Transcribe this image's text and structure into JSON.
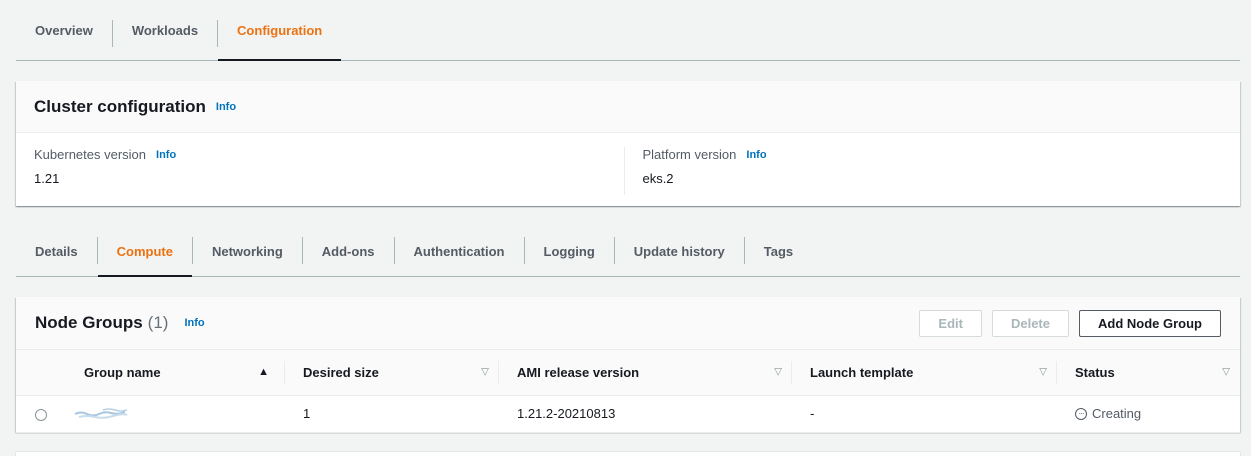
{
  "top_tabs": [
    "Overview",
    "Workloads",
    "Configuration"
  ],
  "top_active": "Configuration",
  "cluster_config": {
    "title": "Cluster configuration",
    "info": "Info",
    "k8s_label": "Kubernetes version",
    "k8s_value": "1.21",
    "platform_label": "Platform version",
    "platform_value": "eks.2"
  },
  "sub_tabs": [
    "Details",
    "Compute",
    "Networking",
    "Add-ons",
    "Authentication",
    "Logging",
    "Update history",
    "Tags"
  ],
  "sub_active": "Compute",
  "node_groups": {
    "title": "Node Groups",
    "count": "(1)",
    "info": "Info",
    "buttons": {
      "edit": "Edit",
      "delete": "Delete",
      "add": "Add Node Group"
    },
    "columns": [
      "Group name",
      "Desired size",
      "AMI release version",
      "Launch template",
      "Status"
    ],
    "rows": [
      {
        "desired_size": "1",
        "ami": "1.21.2-20210813",
        "launch_template": "-",
        "status": "Creating"
      }
    ]
  },
  "colors": {
    "accent": "#ec7211",
    "link": "#0073bb"
  }
}
